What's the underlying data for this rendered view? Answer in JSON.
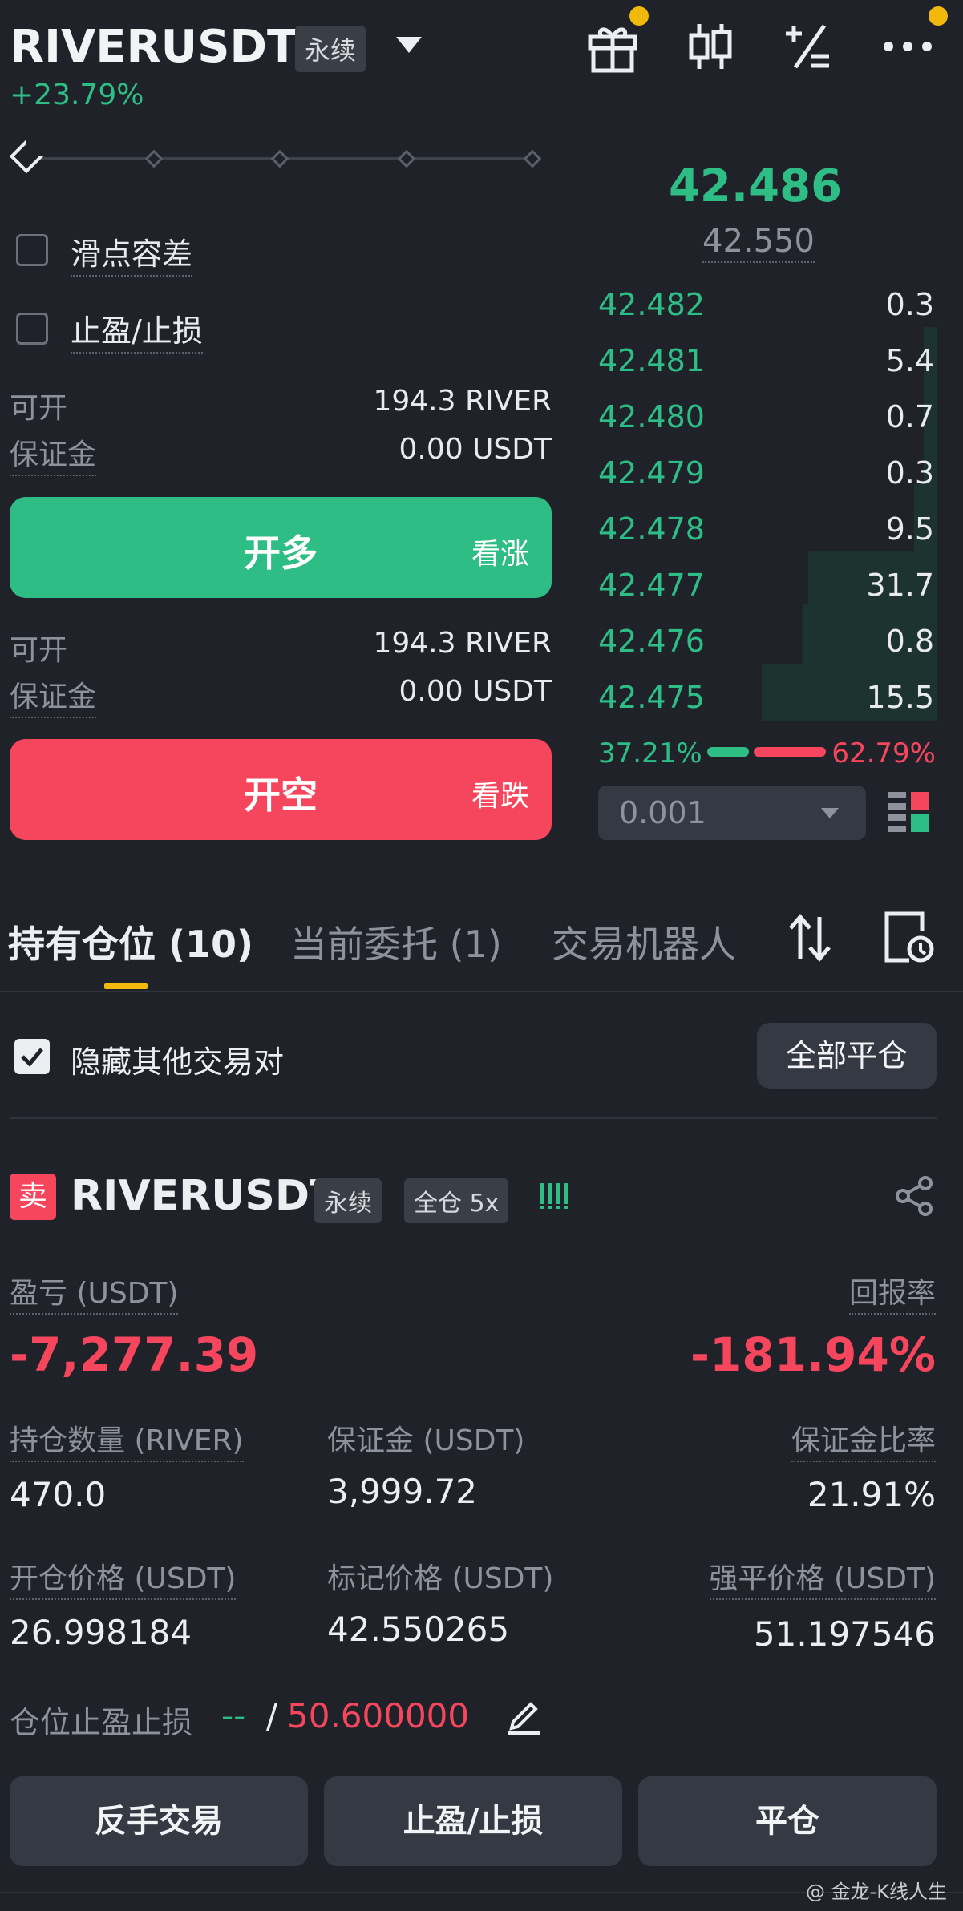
{
  "header": {
    "symbol": "RIVERUSDT",
    "contract_type": "永续",
    "change": "+23.79%",
    "icons": [
      "gift-icon",
      "candlestick-icon",
      "calculator-icon",
      "more-icon"
    ]
  },
  "order_form": {
    "slippage_label": "滑点容差",
    "tpsl_label": "止盈/止损",
    "long": {
      "available_label": "可开",
      "available_value": "194.3 RIVER",
      "margin_label": "保证金",
      "margin_value": "0.00 USDT",
      "button_label": "开多",
      "button_sub": "看涨"
    },
    "short": {
      "available_label": "可开",
      "available_value": "194.3 RIVER",
      "margin_label": "保证金",
      "margin_value": "0.00 USDT",
      "button_label": "开空",
      "button_sub": "看跌"
    }
  },
  "order_book": {
    "last_price": "42.486",
    "mark_price": "42.550",
    "bids": [
      {
        "price": "42.482",
        "qty": "0.3"
      },
      {
        "price": "42.481",
        "qty": "5.4"
      },
      {
        "price": "42.480",
        "qty": "0.7"
      },
      {
        "price": "42.479",
        "qty": "0.3"
      },
      {
        "price": "42.478",
        "qty": "9.5"
      },
      {
        "price": "42.477",
        "qty": "31.7"
      },
      {
        "price": "42.476",
        "qty": "0.8"
      },
      {
        "price": "42.475",
        "qty": "15.5"
      }
    ],
    "buy_ratio": "37.21%",
    "sell_ratio": "62.79%",
    "precision": "0.001"
  },
  "tabs": {
    "positions": "持有仓位 (10)",
    "orders": "当前委托 (1)",
    "bots": "交易机器人"
  },
  "filter": {
    "hide_others_label": "隐藏其他交易对",
    "close_all_label": "全部平仓"
  },
  "position": {
    "side": "卖",
    "symbol": "RIVERUSDT",
    "contract_type": "永续",
    "margin_mode": "全仓 5x",
    "pnl_label": "盈亏 (USDT)",
    "pnl_value": "-7,277.39",
    "roe_label": "回报率",
    "roe_value": "-181.94%",
    "size_label": "持仓数量 (RIVER)",
    "size_value": "470.0",
    "margin_label": "保证金 (USDT)",
    "margin_value": "3,999.72",
    "margin_ratio_label": "保证金比率",
    "margin_ratio_value": "21.91%",
    "entry_label": "开仓价格 (USDT)",
    "entry_value": "26.998184",
    "mark_label": "标记价格 (USDT)",
    "mark_value": "42.550265",
    "liq_label": "强平价格 (USDT)",
    "liq_value": "51.197546",
    "tpsl_label": "仓位止盈止损",
    "tp_value": "--",
    "separator": "/",
    "sl_value": "50.600000"
  },
  "actions": {
    "reverse": "反手交易",
    "tpsl": "止盈/止损",
    "close": "平仓"
  },
  "watermark": "@ 金龙-K线人生",
  "colors": {
    "green": "#2ebd85",
    "red": "#f6465d",
    "accent": "#f0b90b",
    "background": "#1f2229"
  }
}
